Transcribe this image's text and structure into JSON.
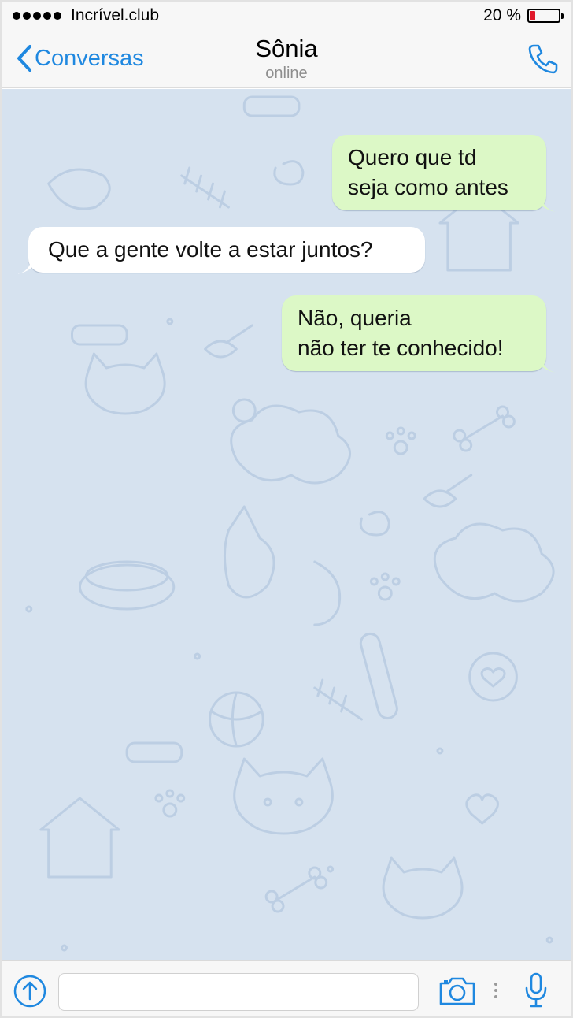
{
  "status_bar": {
    "carrier": "Incrível.club",
    "battery_text": "20 %",
    "battery_level": 0.2,
    "battery_color": "#e0182a"
  },
  "nav": {
    "back_label": "Conversas",
    "contact_name": "Sônia",
    "contact_status": "online",
    "accent_color": "#1f88e0"
  },
  "messages": [
    {
      "direction": "outgoing",
      "lines": [
        "Quero que td",
        "seja como antes"
      ]
    },
    {
      "direction": "incoming",
      "lines": [
        "Que a gente volte a estar juntos?"
      ]
    },
    {
      "direction": "outgoing",
      "lines": [
        "Não, queria",
        "não ter te conhecido!"
      ]
    }
  ],
  "composer": {
    "text": "",
    "icons": [
      "upload-icon",
      "camera-icon",
      "more-dots-icon",
      "microphone-icon"
    ]
  },
  "colors": {
    "chat_background": "#d6e2ef",
    "outgoing_bubble": "#dcf8c6",
    "incoming_bubble": "#ffffff"
  }
}
